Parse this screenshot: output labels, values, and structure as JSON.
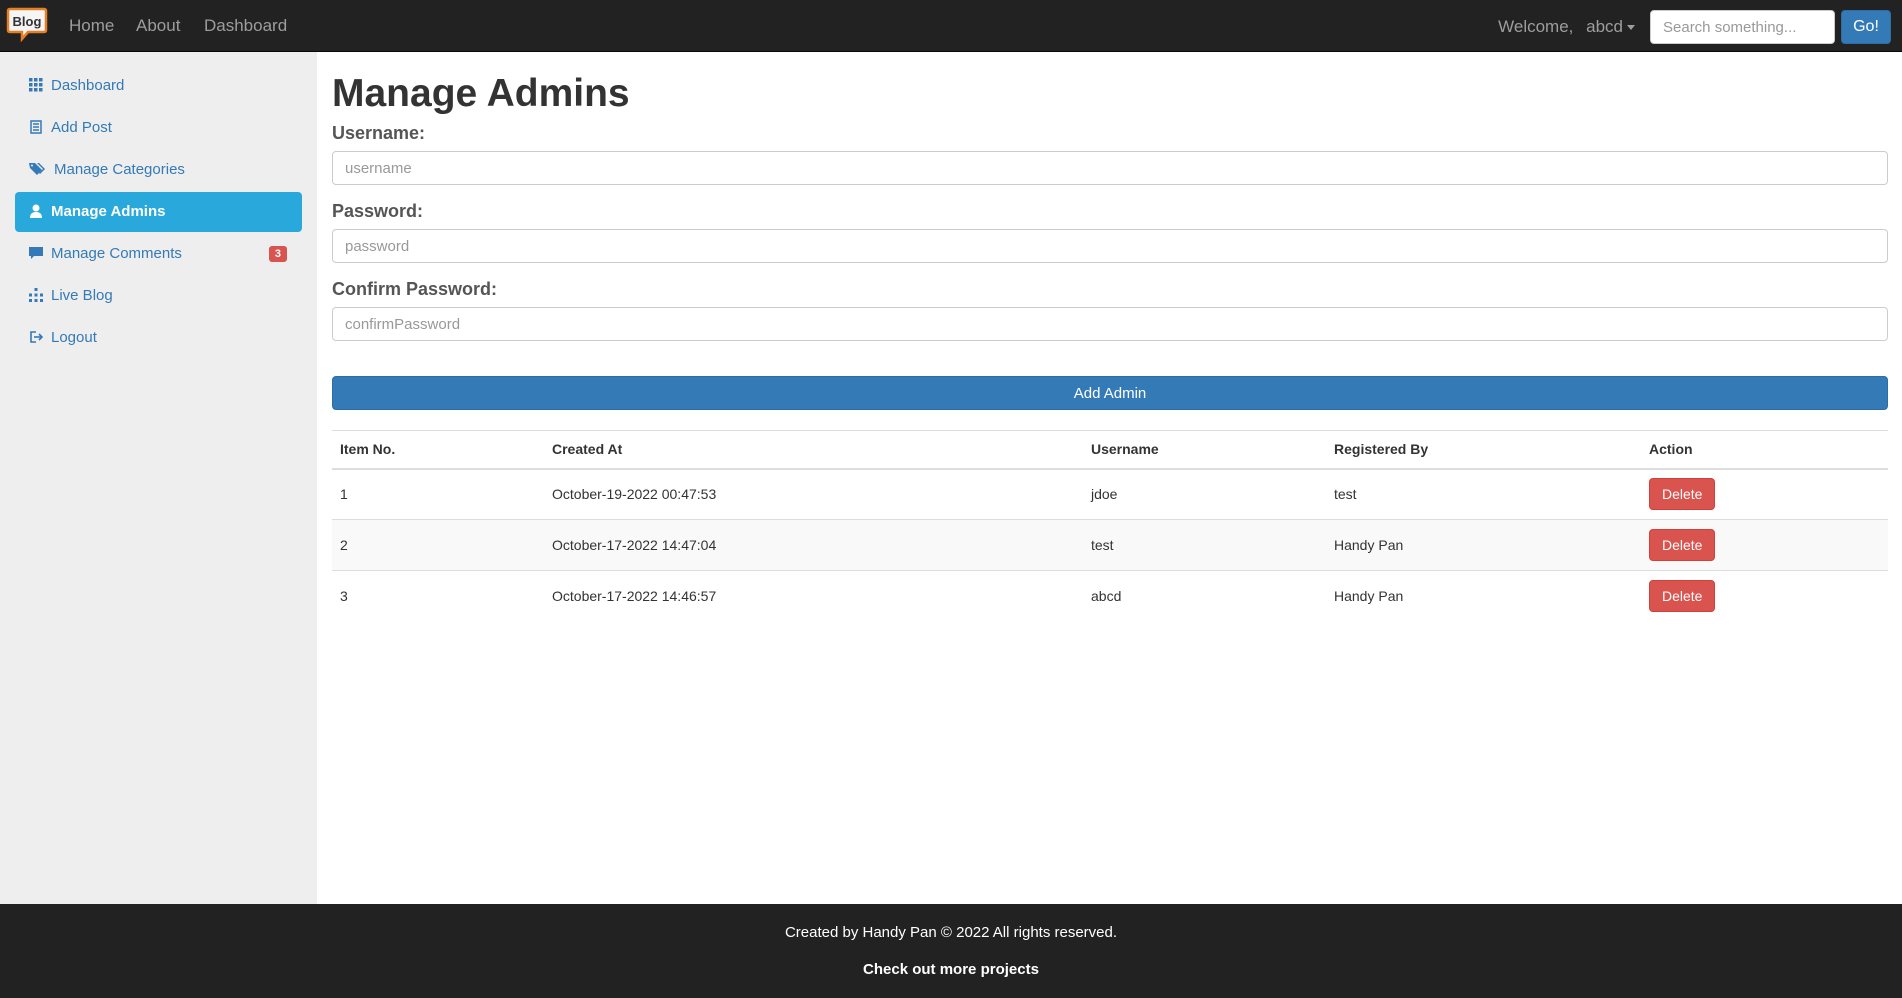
{
  "navbar": {
    "brand": "Blog",
    "links": [
      "Home",
      "About",
      "Dashboard"
    ],
    "welcome_label": "Welcome,",
    "username": "abcd",
    "search_placeholder": "Search something...",
    "go_label": "Go!"
  },
  "sidebar": {
    "items": [
      {
        "label": "Dashboard",
        "icon": "grid-icon"
      },
      {
        "label": "Add Post",
        "icon": "document-icon"
      },
      {
        "label": "Manage Categories",
        "icon": "tags-icon"
      },
      {
        "label": "Manage Admins",
        "icon": "user-icon",
        "active": true
      },
      {
        "label": "Manage Comments",
        "icon": "comment-icon",
        "badge": "3"
      },
      {
        "label": "Live Blog",
        "icon": "sitemap-icon"
      },
      {
        "label": "Logout",
        "icon": "logout-icon"
      }
    ]
  },
  "main": {
    "title": "Manage Admins",
    "username_label": "Username:",
    "username_placeholder": "username",
    "password_label": "Password:",
    "password_placeholder": "password",
    "confirm_label": "Confirm Password:",
    "confirm_placeholder": "confirmPassword",
    "add_button": "Add Admin"
  },
  "table": {
    "headers": [
      "Item No.",
      "Created At",
      "Username",
      "Registered By",
      "Action"
    ],
    "rows": [
      {
        "no": "1",
        "created": "October-19-2022 00:47:53",
        "username": "jdoe",
        "registered_by": "test",
        "action": "Delete"
      },
      {
        "no": "2",
        "created": "October-17-2022 14:47:04",
        "username": "test",
        "registered_by": "Handy Pan",
        "action": "Delete"
      },
      {
        "no": "3",
        "created": "October-17-2022 14:46:57",
        "username": "abcd",
        "registered_by": "Handy Pan",
        "action": "Delete"
      }
    ]
  },
  "footer": {
    "line1": "Created by Handy Pan © 2022 All rights reserved.",
    "line2": "Check out more projects"
  },
  "colors": {
    "navbar_bg": "#222222",
    "primary": "#337ab7",
    "active_sidebar": "#29a8dc",
    "danger": "#d9534f",
    "sidebar_bg": "#eeeeee"
  }
}
